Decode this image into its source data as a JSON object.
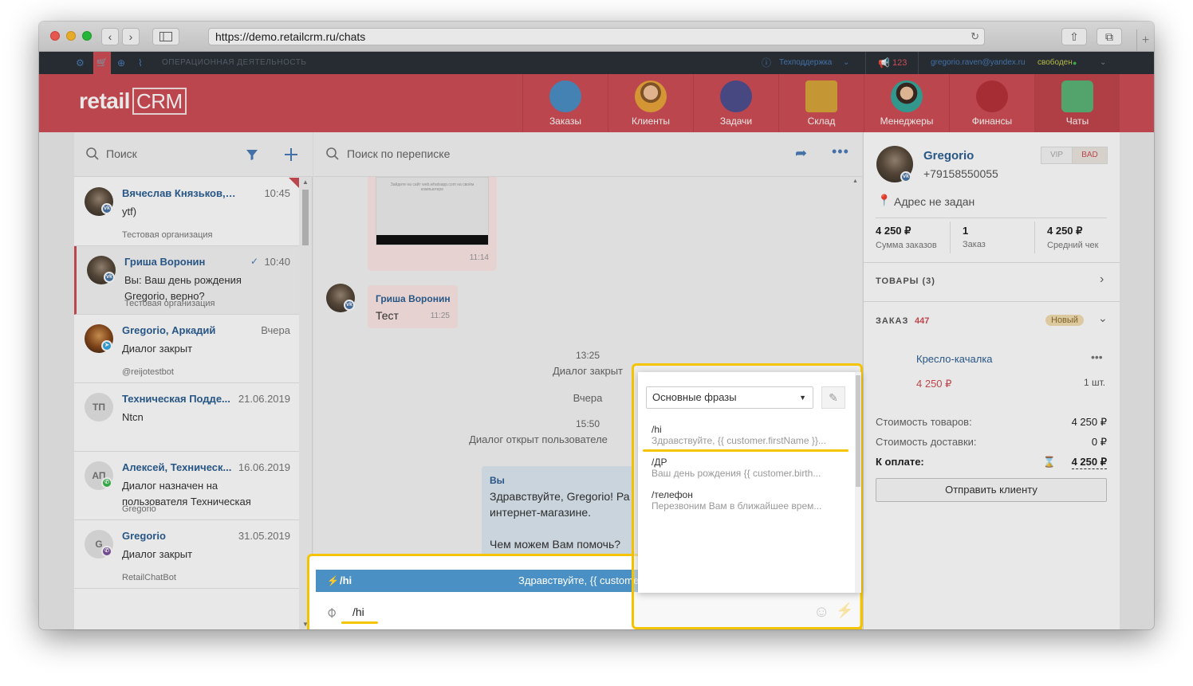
{
  "browser": {
    "url": "https://demo.retailcrm.ru/chats"
  },
  "topbar": {
    "section": "ОПЕРАЦИОННАЯ ДЕЯТЕЛЬНОСТЬ",
    "support": "Техподдержка",
    "calls_count": "123",
    "user_email": "gregorio.raven@yandex.ru",
    "user_status": "свободен"
  },
  "header": {
    "logo": "retail",
    "logo_crm": "CRM",
    "nav": [
      {
        "label": "Заказы",
        "icon": "cart-icon"
      },
      {
        "label": "Клиенты",
        "icon": "customer-icon"
      },
      {
        "label": "Задачи",
        "icon": "tasks-icon"
      },
      {
        "label": "Склад",
        "icon": "box-icon"
      },
      {
        "label": "Менеджеры",
        "icon": "manager-icon"
      },
      {
        "label": "Финансы",
        "icon": "finance-icon"
      },
      {
        "label": "Чаты",
        "icon": "chat-icon"
      }
    ]
  },
  "chatlist": {
    "search_placeholder": "Поиск",
    "items": [
      {
        "name": "Вячеслав Князьков, Тех...",
        "time": "10:45",
        "message": "ytf)",
        "sub": "Тестовая организация",
        "avatar": "",
        "channel": "vk"
      },
      {
        "name": "Гриша Воронин",
        "time": "10:40",
        "message": "Вы: Ваш день рождения Gregorio, верно?",
        "sub": "Тестовая организация",
        "avatar": "",
        "channel": "vk"
      },
      {
        "name": "Gregorio, Аркадий",
        "time": "Вчера",
        "message": "Диалог закрыт",
        "sub": "@reijotestbot",
        "avatar": "",
        "channel": "telegram"
      },
      {
        "name": "Техническая Подде...",
        "time": "21.06.2019",
        "message": "Ntcn",
        "sub": "",
        "avatar": "ТП",
        "channel": ""
      },
      {
        "name": "Алексей, Техническ...",
        "time": "16.06.2019",
        "message": "Диалог назначен на пользователя Техническая",
        "sub": "Gregorio",
        "avatar": "АП",
        "channel": "whatsapp"
      },
      {
        "name": "Gregorio",
        "time": "31.05.2019",
        "message": "Диалог закрыт",
        "sub": "RetailChatBot",
        "avatar": "G",
        "channel": "viber"
      }
    ]
  },
  "conversation": {
    "search_placeholder": "Поиск по переписке",
    "image_time": "11:14",
    "image_caption": "Зайдите на сайт web.whatsapp.com на своём компьютере",
    "incoming": {
      "author": "Гриша Воронин",
      "text": "Тест",
      "time": "11:25"
    },
    "sys1_time": "13:25",
    "sys1_text": "Диалог закрыт",
    "day": "Вчера",
    "sys2_time": "15:50",
    "sys2_text": "Диалог открыт пользователе",
    "outgoing": {
      "author": "Вы",
      "line1": "Здравствуйте, Gregorio! Ра",
      "line2": "интернет-магазине.",
      "line3": "Чем можем Вам помочь?"
    }
  },
  "composer": {
    "suggest_key": "/hi",
    "suggest_text": "Здравствуйте, {{ custome",
    "input_value": "/hi"
  },
  "phrases": {
    "group": "Основные фразы",
    "items": [
      {
        "title": "/hi",
        "text": "Здравствуйте, {{ customer.firstName }}..."
      },
      {
        "title": "/ДР",
        "text": "Ваш день рождения {{ customer.birth..."
      },
      {
        "title": "/телефон",
        "text": "Перезвоним Вам в ближайшее врем..."
      }
    ]
  },
  "customer": {
    "name": "Gregorio",
    "phone": "+79158550055",
    "tag_vip": "VIP",
    "tag_bad": "BAD",
    "address": "Адрес не задан",
    "stats": [
      {
        "value": "4 250 ₽",
        "label": "Сумма заказов"
      },
      {
        "value": "1",
        "label": "Заказ"
      },
      {
        "value": "4 250 ₽",
        "label": "Средний чек"
      }
    ],
    "goods_label": "ТОВАРЫ (3)",
    "order_label": "ЗАКАЗ",
    "order_number": "447",
    "order_status": "Новый",
    "product_name": "Кресло-качалка",
    "product_price": "4 250 ₽",
    "product_qty": "1 шт.",
    "goods_cost_label": "Стоимость товаров:",
    "goods_cost": "4 250 ₽",
    "delivery_label": "Стоимость доставки:",
    "delivery_cost": "0 ₽",
    "total_label": "К оплате:",
    "total": "4 250 ₽",
    "send_button": "Отправить клиенту"
  },
  "colors": {
    "brand_red": "#cf4e55",
    "link_blue": "#2c5f93",
    "highlight_yellow": "#f5c400",
    "suggest_blue": "#4a90c5"
  }
}
